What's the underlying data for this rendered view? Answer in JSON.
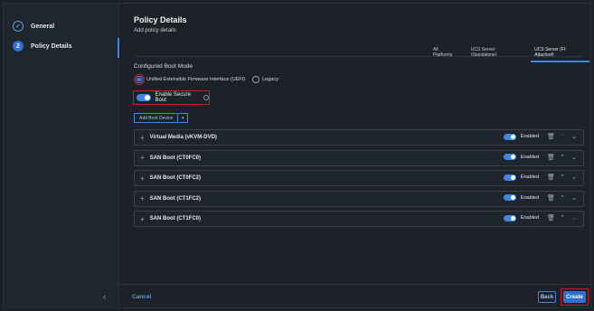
{
  "sidebar": {
    "steps": [
      {
        "number": "",
        "label": "General",
        "state": "done"
      },
      {
        "number": "2",
        "label": "Policy Details",
        "state": "active"
      }
    ],
    "collapse_icon": "chevron-left-icon"
  },
  "header": {
    "title": "Policy Details",
    "subtitle": "Add policy details"
  },
  "tabs": [
    {
      "label": "All Platforms",
      "active": false
    },
    {
      "label": "UCS Server (Standalone)",
      "active": false
    },
    {
      "label": "UCS Server (FI-Attached)",
      "active": true
    }
  ],
  "boot_mode": {
    "label": "Configured Boot Mode",
    "options": [
      {
        "label": "Unified Extensible Firmware Interface (UEFI)",
        "selected": true
      },
      {
        "label": "Legacy",
        "selected": false
      }
    ]
  },
  "secure_boot": {
    "label": "Enable Secure Boot",
    "enabled": true
  },
  "add_boot_device": {
    "label": "Add Boot Device",
    "caret_icon": "chevron-down-icon"
  },
  "devices": [
    {
      "name": "Virtual Media (vKVM-DVD)",
      "status": "Enabled"
    },
    {
      "name": "SAN Boot (CT0FC0)",
      "status": "Enabled"
    },
    {
      "name": "SAN Boot (CT0FC2)",
      "status": "Enabled"
    },
    {
      "name": "SAN Boot (CT1FC2)",
      "status": "Enabled"
    },
    {
      "name": "SAN Boot (CT1FC0)",
      "status": "Enabled"
    }
  ],
  "footer": {
    "cancel_label": "Cancel",
    "back_label": "Back",
    "create_label": "Create"
  },
  "colors": {
    "accent": "#3f86e6",
    "highlight": "#c41f2b",
    "background": "#1d2229"
  }
}
